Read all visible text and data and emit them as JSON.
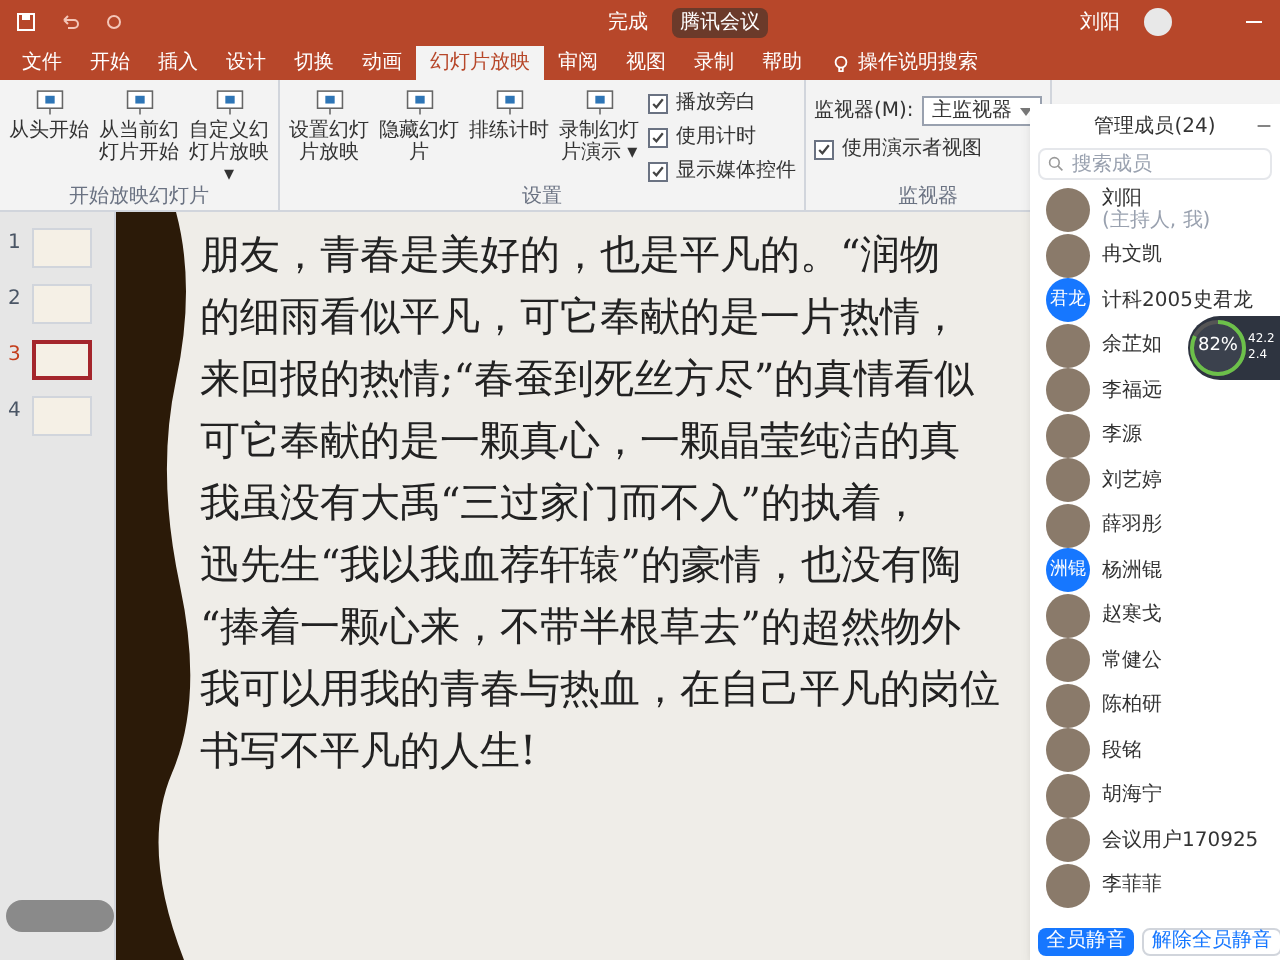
{
  "titlebar": {
    "title": "完成",
    "meeting_badge": "腾讯会议",
    "user": "刘阳"
  },
  "tabs": [
    {
      "label": "文件",
      "selected": false
    },
    {
      "label": "开始",
      "selected": false
    },
    {
      "label": "插入",
      "selected": false
    },
    {
      "label": "设计",
      "selected": false
    },
    {
      "label": "切换",
      "selected": false
    },
    {
      "label": "动画",
      "selected": false
    },
    {
      "label": "幻灯片放映",
      "selected": true
    },
    {
      "label": "审阅",
      "selected": false
    },
    {
      "label": "视图",
      "selected": false
    },
    {
      "label": "录制",
      "selected": false
    },
    {
      "label": "帮助",
      "selected": false
    }
  ],
  "tell_me": "操作说明搜索",
  "ribbon": [
    {
      "group": "开始放映幻灯片",
      "items": [
        {
          "kind": "button",
          "label": "从头开始"
        },
        {
          "kind": "button",
          "label": "从当前幻灯片开始"
        },
        {
          "kind": "button",
          "label": "自定义幻灯片放映 ▾"
        }
      ]
    },
    {
      "group": "设置",
      "items": [
        {
          "kind": "button",
          "label": "设置幻灯片放映"
        },
        {
          "kind": "button",
          "label": "隐藏幻灯片"
        },
        {
          "kind": "button",
          "label": "排练计时"
        },
        {
          "kind": "button",
          "label": "录制幻灯片演示 ▾"
        },
        {
          "kind": "checks",
          "checks": [
            {
              "label": "播放旁白",
              "checked": true
            },
            {
              "label": "使用计时",
              "checked": true
            },
            {
              "label": "显示媒体控件",
              "checked": true
            }
          ]
        }
      ]
    },
    {
      "group": "监视器",
      "items": [
        {
          "kind": "monitor",
          "label": "监视器(M):",
          "value": "主监视器",
          "checks": [
            {
              "label": "使用演示者视图",
              "checked": true
            }
          ]
        }
      ]
    }
  ],
  "thumbnails": [
    {
      "number": "1",
      "selected": false
    },
    {
      "number": "2",
      "selected": false
    },
    {
      "number": "3",
      "selected": true
    },
    {
      "number": "4",
      "selected": false
    }
  ],
  "slide_lines": [
    "朋友，青春是美好的，也是平凡的。“润物",
    "的细雨看似平凡，可它奉献的是一片热情，",
    "来回报的热情;“春蚕到死丝方尽”的真情看似",
    "可它奉献的是一颗真心，一颗晶莹纯洁的真",
    "我虽没有大禹“三过家门而不入”的执着，",
    "迅先生“我以我血荐轩辕”的豪情，也没有陶",
    "“捧着一颗心来，不带半根草去”的超然物外",
    "我可以用我的青春与热血，在自己平凡的岗位",
    "书写不平凡的人生!"
  ],
  "members_panel": {
    "title": "管理成员(24)",
    "search_placeholder": "搜索成员",
    "members": [
      {
        "name": "刘阳",
        "note": "(主持人, 我)",
        "kind": "photo"
      },
      {
        "name": "冉文凯",
        "kind": "photo"
      },
      {
        "name": "计科2005史君龙",
        "kind": "initials",
        "initials": "君龙"
      },
      {
        "name": "余芷如",
        "kind": "photo"
      },
      {
        "name": "李福远",
        "kind": "photo"
      },
      {
        "name": "李源",
        "kind": "photo"
      },
      {
        "name": "刘艺婷",
        "kind": "photo"
      },
      {
        "name": "薛羽彤",
        "kind": "photo"
      },
      {
        "name": "杨洲锟",
        "kind": "initials",
        "initials": "洲锟"
      },
      {
        "name": "赵寒戈",
        "kind": "photo"
      },
      {
        "name": "常健公",
        "kind": "photo"
      },
      {
        "name": "陈柏研",
        "kind": "photo"
      },
      {
        "name": "段铭",
        "kind": "photo"
      },
      {
        "name": "胡海宁",
        "kind": "photo"
      },
      {
        "name": "会议用户170925",
        "kind": "photo"
      },
      {
        "name": "李菲菲",
        "kind": "photo"
      }
    ],
    "buttons": [
      "全员静音",
      "解除全员静音"
    ]
  },
  "perf_gauge": {
    "value": "82%",
    "level": 0.82,
    "upload": "42.2",
    "download": "2.4"
  }
}
